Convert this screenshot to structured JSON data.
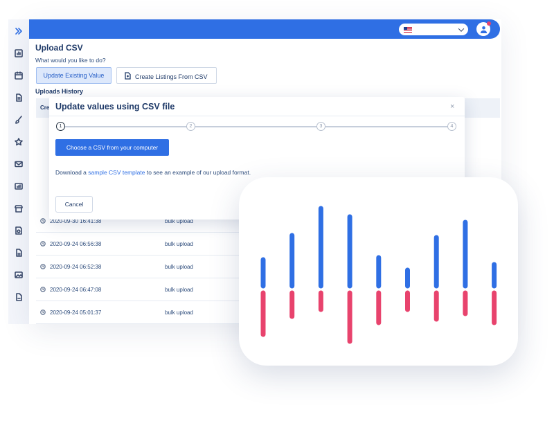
{
  "header": {
    "language_flag": "us-flag-icon",
    "avatar_icon": "user-icon"
  },
  "page": {
    "title": "Upload CSV",
    "prompt": "What would you like to do?",
    "update_button": "Update Existing Value",
    "create_button": "Create Listings From CSV",
    "history_title": "Uploads History"
  },
  "table": {
    "header_visible": "Cre",
    "rows": [
      {
        "date": "2020-09-30 16:41:38",
        "type": "bulk upload"
      },
      {
        "date": "2020-09-24 06:56:38",
        "type": "bulk upload"
      },
      {
        "date": "2020-09-24 06:52:38",
        "type": "bulk upload"
      },
      {
        "date": "2020-09-24 06:47:08",
        "type": "bulk upload"
      },
      {
        "date": "2020-09-24 05:01:37",
        "type": "bulk upload"
      }
    ]
  },
  "modal": {
    "title": "Update values using CSV file",
    "close": "×",
    "steps": [
      "1",
      "2",
      "3",
      "4"
    ],
    "active_step": 1,
    "choose_button": "Choose a CSV from your computer",
    "download_prefix": "Download a ",
    "download_link": "sample CSV template",
    "download_suffix": " to see an example of our upload format.",
    "cancel_button": "Cancel"
  },
  "colors": {
    "primary": "#2f6fe4",
    "accent_pink": "#e8436d",
    "text_dark": "#1f3a68"
  },
  "chart_data": {
    "type": "bar",
    "categories": [
      "",
      "",
      "",
      "",
      "",
      "",
      "",
      "",
      ""
    ],
    "series": [
      {
        "values": [
          38,
          73,
          112,
          100,
          41,
          23,
          70,
          92,
          31
        ]
      },
      {
        "values": [
          -60,
          -34,
          -24,
          -70,
          -43,
          -24,
          -38,
          -30,
          -43
        ]
      }
    ],
    "ylim": [
      -80,
      120
    ],
    "colors": [
      "#2f6fe4",
      "#e8436d"
    ],
    "grid": false
  }
}
